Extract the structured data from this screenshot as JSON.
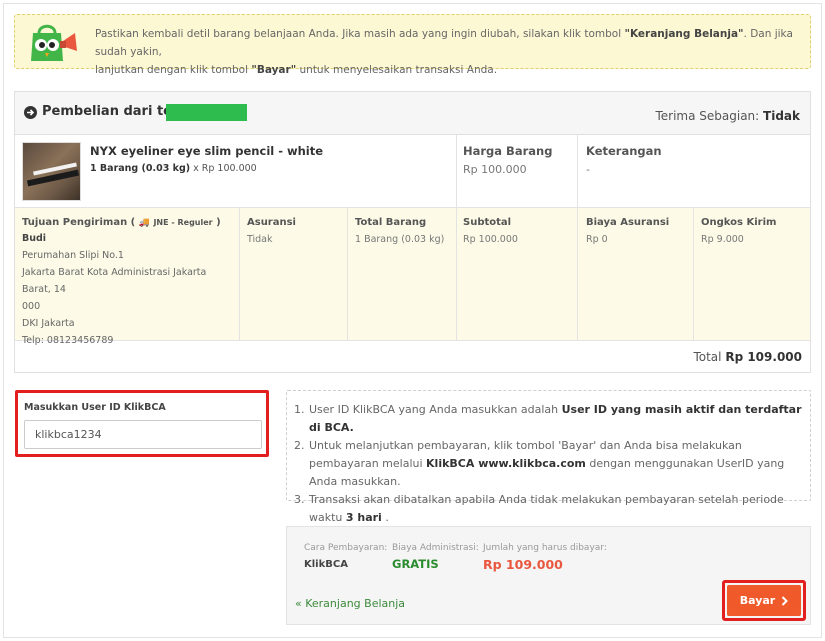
{
  "notice": {
    "line1_a": "Pastikan kembali detil barang belanjaan Anda. Jika masih ada yang ingin diubah, silakan klik tombol ",
    "line1_b": "\"Keranjang Belanja\"",
    "line1_c": ". Dan jika sudah yakin,",
    "line2_a": "lanjutkan dengan klik tombol ",
    "line2_b": "\"Bayar\"",
    "line2_c": " untuk menyelesaikan transaksi Anda."
  },
  "order": {
    "store_prefix": "Pembelian dari toko:",
    "partial_label": "Terima Sebagian:",
    "partial_value": "Tidak",
    "product_name": "NYX eyeliner eye slim pencil - white",
    "product_qty": "1 Barang (0.03 kg)",
    "product_qty_price": "x Rp 100.000",
    "price_title": "Harga Barang",
    "price_value": "Rp 100.000",
    "note_title": "Keterangan",
    "note_value": "-",
    "shipping": {
      "title": "Tujuan Pengiriman (",
      "courier": "JNE - Reguler",
      "title_close": ")",
      "name": "Budi",
      "address1": "Perumahan Slipi No.1",
      "address2": "Jakarta Barat Kota Administrasi Jakarta Barat, 14",
      "address3": "000",
      "province": "DKI Jakarta",
      "phone": "Telp: 08123456789"
    },
    "insurance_title": "Asuransi",
    "insurance_value": "Tidak",
    "total_items_title": "Total Barang",
    "total_items_value": "1 Barang (0.03 kg)",
    "subtotal_title": "Subtotal",
    "subtotal_value": "Rp 100.000",
    "insurance_fee_title": "Biaya Asuransi",
    "insurance_fee_value": "Rp 0",
    "shipping_cost_title": "Ongkos Kirim",
    "shipping_cost_value": "Rp 9.000",
    "total_label": "Total",
    "total_value": "Rp 109.000"
  },
  "klikbca": {
    "label": "Masukkan User ID KlikBCA",
    "value": "klikbca1234"
  },
  "instructions": [
    {
      "n": "1.",
      "a": "User ID KlikBCA yang Anda masukkan adalah ",
      "b": "User ID yang masih aktif dan terdaftar di BCA.",
      "c": ""
    },
    {
      "n": "2.",
      "a": "Untuk melanjutkan pembayaran, klik tombol 'Bayar' dan Anda bisa melakukan pembayaran melalui ",
      "b": "KlikBCA www.klikbca.com",
      "c": " dengan menggunakan UserID yang Anda masukkan."
    },
    {
      "n": "3.",
      "a": "Transaksi akan dibatalkan apabila Anda tidak melakukan pembayaran setelah periode waktu ",
      "b": "3 hari",
      "c": " ."
    }
  ],
  "payment": {
    "method_label": "Cara Pembayaran:",
    "method_value": "KlikBCA",
    "fee_label": "Biaya Administrasi:",
    "fee_value": "GRATIS",
    "amount_label": "Jumlah yang harus dibayar:",
    "amount_value": "Rp 109.000",
    "back_link": "« Keranjang Belanja",
    "pay_button": "Bayar"
  },
  "colors": {
    "accent": "#f0592a",
    "highlight_border": "#e31e1e",
    "notice_bg": "#fdf8d4",
    "free_green": "#2a8c2e",
    "amount_orange": "#e9573f",
    "store_redaction": "#2ebc4f"
  }
}
